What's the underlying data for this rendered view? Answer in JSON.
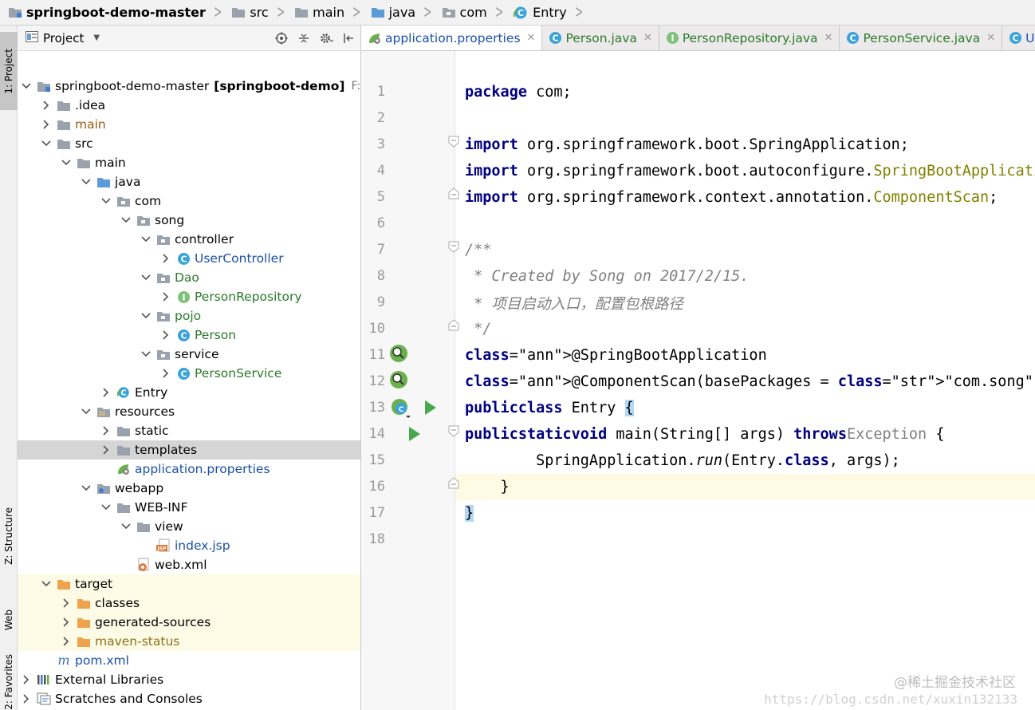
{
  "breadcrumb": [
    {
      "label": "springboot-demo-master",
      "icon": "module-folder-icon"
    },
    {
      "label": "src",
      "icon": "folder-icon"
    },
    {
      "label": "main",
      "icon": "folder-icon"
    },
    {
      "label": "java",
      "icon": "source-folder-icon"
    },
    {
      "label": "com",
      "icon": "package-icon"
    },
    {
      "label": "Entry",
      "icon": "spring-class-icon"
    }
  ],
  "side_tabs": {
    "project": "1: Project",
    "structure": "Z: Structure",
    "web": "Web",
    "favorites": "2: Favorites"
  },
  "project_panel": {
    "title": "Project",
    "tree": [
      {
        "label": "springboot-demo-master",
        "bold_suffix": "[springboot-demo]",
        "hint": "F:\\Ide",
        "arrow": "down",
        "icon": "module",
        "color": ""
      },
      {
        "label": ".idea",
        "arrow": "right",
        "icon": "folder",
        "color": ""
      },
      {
        "label": "main",
        "arrow": "right",
        "icon": "folder",
        "color": "brown"
      },
      {
        "label": "src",
        "arrow": "down",
        "icon": "folder",
        "color": ""
      },
      {
        "label": "main",
        "arrow": "down",
        "icon": "folder",
        "color": ""
      },
      {
        "label": "java",
        "arrow": "down",
        "icon": "src-folder",
        "color": ""
      },
      {
        "label": "com",
        "arrow": "down",
        "icon": "package",
        "color": ""
      },
      {
        "label": "song",
        "arrow": "down",
        "icon": "package",
        "color": ""
      },
      {
        "label": "controller",
        "arrow": "down",
        "icon": "package",
        "color": ""
      },
      {
        "label": "UserController",
        "arrow": "right",
        "icon": "class",
        "color": "blue"
      },
      {
        "label": "Dao",
        "arrow": "down",
        "icon": "package",
        "color": "green"
      },
      {
        "label": "PersonRepository",
        "arrow": "right",
        "icon": "interface",
        "color": "green"
      },
      {
        "label": "pojo",
        "arrow": "down",
        "icon": "package",
        "color": "green"
      },
      {
        "label": "Person",
        "arrow": "right",
        "icon": "class",
        "color": "green"
      },
      {
        "label": "service",
        "arrow": "down",
        "icon": "package",
        "color": ""
      },
      {
        "label": "PersonService",
        "arrow": "right",
        "icon": "class",
        "color": "green"
      },
      {
        "label": "Entry",
        "arrow": "right",
        "icon": "spring-class",
        "color": ""
      },
      {
        "label": "resources",
        "arrow": "down",
        "icon": "res-folder",
        "color": ""
      },
      {
        "label": "static",
        "arrow": "right",
        "icon": "folder",
        "color": ""
      },
      {
        "label": "templates",
        "arrow": "right",
        "icon": "folder",
        "color": ""
      },
      {
        "label": "application.properties",
        "arrow": "",
        "icon": "properties",
        "color": "blue"
      },
      {
        "label": "webapp",
        "arrow": "down",
        "icon": "web-folder",
        "color": ""
      },
      {
        "label": "WEB-INF",
        "arrow": "down",
        "icon": "folder",
        "color": ""
      },
      {
        "label": "view",
        "arrow": "down",
        "icon": "folder",
        "color": ""
      },
      {
        "label": "index.jsp",
        "arrow": "",
        "icon": "jsp",
        "color": "blue"
      },
      {
        "label": "web.xml",
        "arrow": "",
        "icon": "xml",
        "color": ""
      },
      {
        "label": "target",
        "arrow": "down",
        "icon": "excluded-folder",
        "color": ""
      },
      {
        "label": "classes",
        "arrow": "right",
        "icon": "excluded-folder",
        "color": ""
      },
      {
        "label": "generated-sources",
        "arrow": "right",
        "icon": "excluded-folder",
        "color": ""
      },
      {
        "label": "maven-status",
        "arrow": "right",
        "icon": "excluded-folder",
        "color": "olive"
      },
      {
        "label": "pom.xml",
        "arrow": "",
        "icon": "maven",
        "color": "blue"
      },
      {
        "label": "External Libraries",
        "arrow": "right",
        "icon": "libraries",
        "color": ""
      },
      {
        "label": "Scratches and Consoles",
        "arrow": "right",
        "icon": "scratches",
        "color": ""
      }
    ]
  },
  "editor_tabs": [
    {
      "label": "application.properties",
      "icon": "properties",
      "active": true
    },
    {
      "label": "Person.java",
      "icon": "class",
      "active": false
    },
    {
      "label": "PersonRepository.java",
      "icon": "interface",
      "active": false
    },
    {
      "label": "PersonService.java",
      "icon": "class",
      "active": false
    },
    {
      "label": "UserCo",
      "icon": "class",
      "active": false
    }
  ],
  "editor": {
    "line_numbers": [
      "1",
      "2",
      "3",
      "4",
      "5",
      "6",
      "7",
      "8",
      "9",
      "10",
      "11",
      "12",
      "13",
      "14",
      "15",
      "16",
      "17",
      "18"
    ],
    "code_lines": [
      "package com;",
      "",
      "import org.springframework.boot.SpringApplication;",
      "import org.springframework.boot.autoconfigure.SpringBootApplicati",
      "import org.springframework.context.annotation.ComponentScan;",
      "",
      "/**",
      " * Created by Song on 2017/2/15.",
      " * 项目启动入口，配置包根路径",
      " */",
      "@SpringBootApplication",
      "@ComponentScan(basePackages = \"com.song\")",
      "public class Entry {",
      "    public static void main(String[] args) throws Exception {",
      "        SpringApplication.run(Entry.class, args);",
      "    }",
      "}",
      ""
    ]
  },
  "watermark": {
    "line1": "@稀土掘金技术社区",
    "line2": "https://blog.csdn.net/xuxin132133"
  }
}
